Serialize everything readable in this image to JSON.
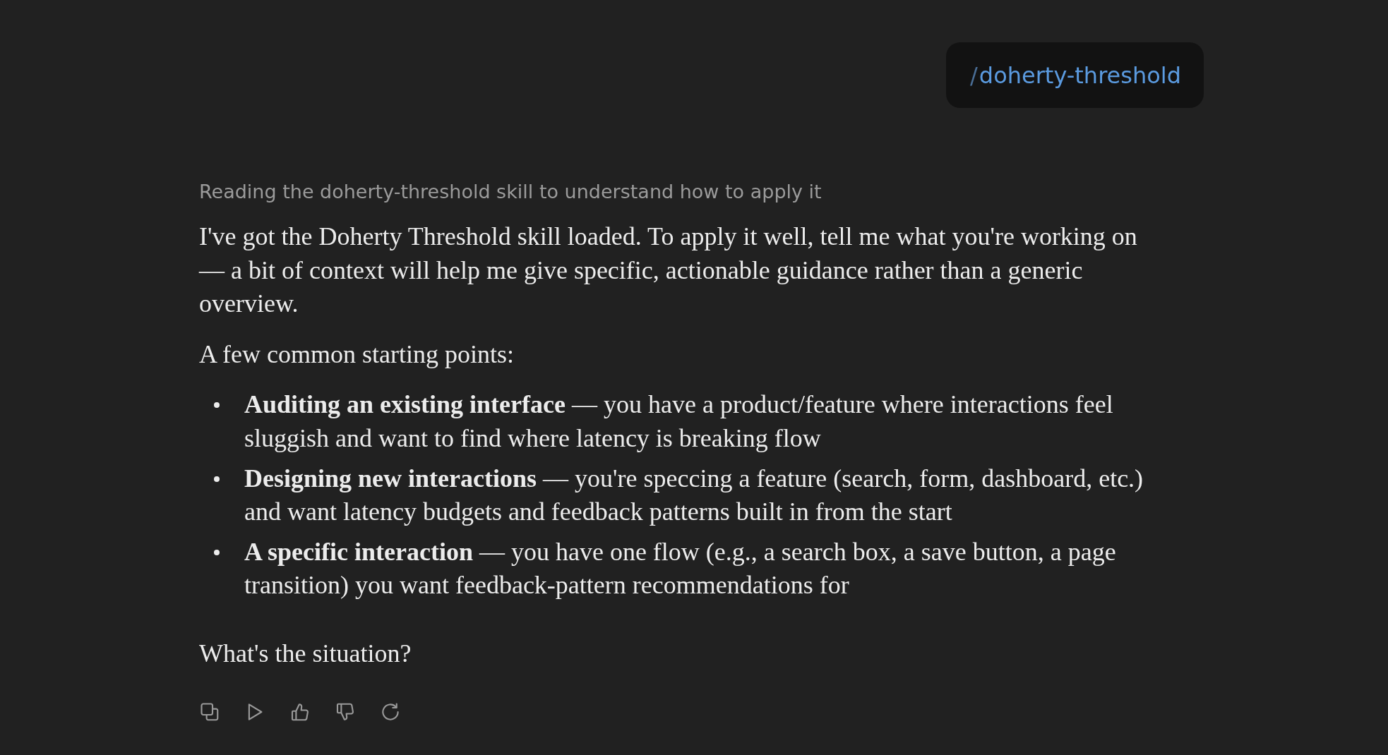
{
  "user_message": {
    "prefix": "/",
    "command": "doherty-threshold"
  },
  "assistant_message": {
    "status": "Reading the doherty-threshold skill to understand how to apply it",
    "blocks": [
      {
        "kind": "paragraph",
        "text": "I've got the Doherty Threshold skill loaded. To apply it well, tell me what you're working on — a bit of context will help me give specific, actionable guidance rather than a generic overview."
      },
      {
        "kind": "paragraph",
        "text": "A few common starting points:"
      },
      {
        "kind": "list",
        "items": [
          "**Auditing an existing interface** — you have a product/feature where interactions feel sluggish and want to find where latency is breaking flow",
          "**Designing new interactions** — you're speccing a feature (search, form, dashboard, etc.) and want latency budgets and feedback patterns built in from the start",
          "**A specific interaction** — you have one flow (e.g., a search box, a save button, a page transition) you want feedback-pattern recommendations for"
        ]
      },
      {
        "kind": "paragraph",
        "text": "What's the situation?"
      }
    ]
  }
}
